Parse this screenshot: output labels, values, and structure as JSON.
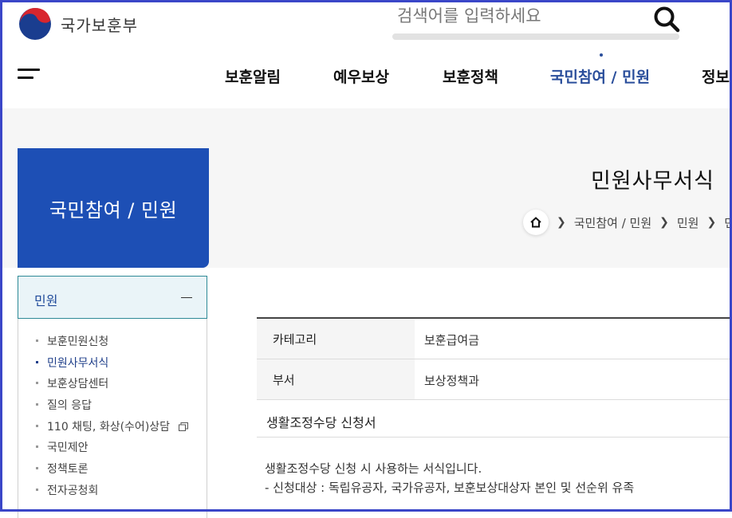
{
  "site": {
    "logo_text": "국가보훈부"
  },
  "search": {
    "placeholder": "검색어를 입력하세요"
  },
  "gnb": {
    "items": [
      {
        "label": "보훈알림"
      },
      {
        "label": "예우보상"
      },
      {
        "label": "보훈정책"
      },
      {
        "label": "국민참여 / 민원",
        "active": true
      },
      {
        "label": "정보"
      }
    ]
  },
  "side_title": "국민참여 / 민원",
  "page_title": "민원사무서식",
  "breadcrumb": {
    "items": [
      "국민참여 / 민원",
      "민원",
      "민"
    ]
  },
  "lnb": {
    "header": "민원",
    "items": [
      {
        "label": "보훈민원신청"
      },
      {
        "label": "민원사무서식",
        "current": true
      },
      {
        "label": "보훈상담센터"
      },
      {
        "label": "질의 응답"
      },
      {
        "label": "110 채팅, 화상(수어)상담",
        "external": true
      },
      {
        "label": "국민제안"
      },
      {
        "label": "정책토론"
      },
      {
        "label": "전자공청회"
      }
    ]
  },
  "detail": {
    "rows": [
      {
        "label": "카테고리",
        "value": "보훈급여금"
      },
      {
        "label": "부서",
        "value": "보상정책과"
      }
    ],
    "doc_title": "생활조정수당 신청서",
    "description": [
      "생활조정수당 신청 시 사용하는 서식입니다.",
      "- 신청대상 : 독립유공자, 국가유공자, 보훈보상대상자 본인 및 선순위 유족"
    ]
  },
  "colors": {
    "brand_blue": "#1d4fb5",
    "active_nav": "#2a4e9b",
    "frame": "#3a46c8"
  }
}
